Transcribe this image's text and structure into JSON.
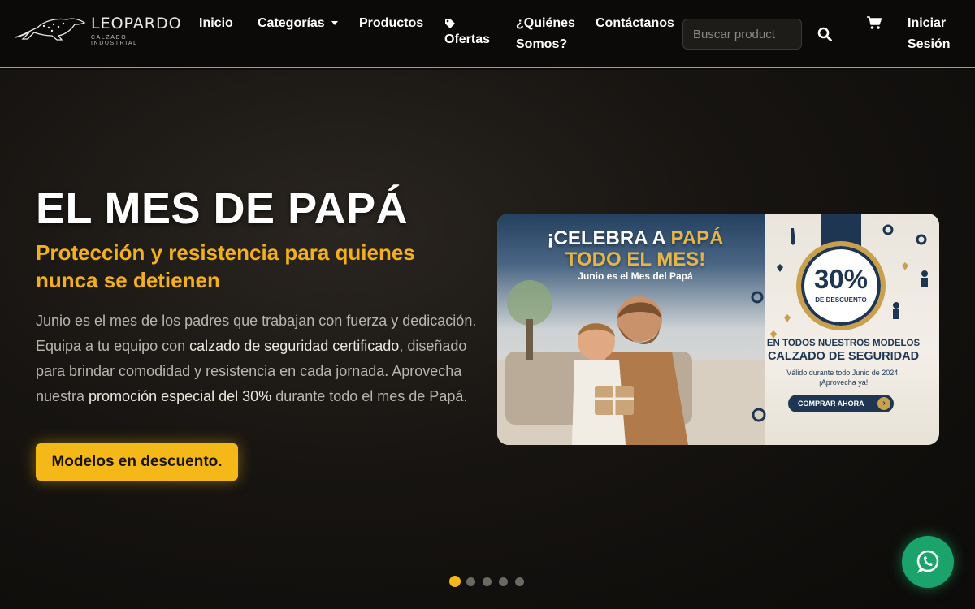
{
  "brand": {
    "name": "LEOPARDO",
    "tagline": "CALZADO INDUSTRIAL"
  },
  "nav": {
    "inicio": "Inicio",
    "categorias": "Categorías",
    "productos": "Productos",
    "ofertas": "Ofertas",
    "quienes_1": "¿Quiénes",
    "quienes_2": "Somos?",
    "contacto": "Contáctanos",
    "login_1": "Iniciar",
    "login_2": "Sesión"
  },
  "search": {
    "placeholder": "Buscar product"
  },
  "hero": {
    "title": "EL MES DE PAPÁ",
    "subtitle": "Protección y resistencia para quienes nunca se detienen",
    "body_1": "Junio es el mes de los padres que trabajan con fuerza y dedicación. Equipa a tu equipo con ",
    "body_bold_1": "calzado de seguridad certificado",
    "body_2": ", diseñado para brindar comodidad y resistencia en cada jornada. Aprovecha nuestra ",
    "body_bold_2": "promoción especial del 30%",
    "body_3": " durante todo el mes de Papá.",
    "cta": "Modelos en descuento."
  },
  "banner": {
    "title_1": "¡CELEBRA A ",
    "title_gold": "PAPÁ",
    "title_2": "TODO EL MES!",
    "subtitle": "Junio es el Mes del Papá",
    "discount": "30%",
    "discount_label": "DE DESCUENTO",
    "line1": "EN TODOS NUESTROS MODELOS",
    "line2": "CALZADO DE SEGURIDAD",
    "line3a": "Válido durante todo Junio de 2024.",
    "line3b": "¡Aprovecha ya!",
    "button": "COMPRAR AHORA"
  },
  "carousel": {
    "slides": 5,
    "active": 1
  },
  "colors": {
    "accent": "#f4b918",
    "nav_border": "#c89a3c",
    "whatsapp": "#1aa36a",
    "banner_navy": "#1f3652"
  },
  "icons": [
    "leopard-logo",
    "tag-icon",
    "search-icon",
    "cart-icon",
    "whatsapp-icon",
    "chevron-down-icon"
  ]
}
